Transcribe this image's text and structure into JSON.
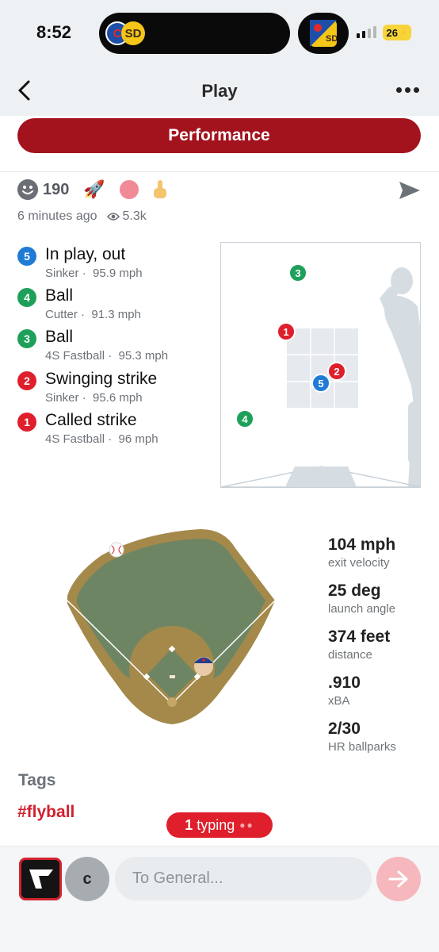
{
  "status_bar": {
    "time": "8:52",
    "battery": "26",
    "live_activity": {
      "away_team_icon": "cubs-logo-icon",
      "home_team_icon": "padres-logo-icon"
    }
  },
  "nav": {
    "title": "Play",
    "back_icon": "chevron-left-icon",
    "more_icon": "more-horizontal-icon"
  },
  "performance_button": "Performance",
  "post": {
    "reaction_count": "190",
    "reactions": [
      "rocket-emoji",
      "pink-circle-emoji",
      "finger-emoji"
    ],
    "time_ago": "6 minutes ago",
    "views": "5.3k"
  },
  "pitches": [
    {
      "num": "5",
      "result": "In play, out",
      "pitch_type": "Sinker",
      "speed": "95.9 mph",
      "color": "#1f7bd6"
    },
    {
      "num": "4",
      "result": "Ball",
      "pitch_type": "Cutter",
      "speed": "91.3 mph",
      "color": "#1fa05a"
    },
    {
      "num": "3",
      "result": "Ball",
      "pitch_type": "4S Fastball",
      "speed": "95.3 mph",
      "color": "#1fa05a"
    },
    {
      "num": "2",
      "result": "Swinging strike",
      "pitch_type": "Sinker",
      "speed": "95.6 mph",
      "color": "#df1f2c"
    },
    {
      "num": "1",
      "result": "Called strike",
      "pitch_type": "4S Fastball",
      "speed": "96 mph",
      "color": "#df1f2c"
    }
  ],
  "zone_markers": [
    {
      "num": "3",
      "color": "#1fa05a"
    },
    {
      "num": "1",
      "color": "#df1f2c"
    },
    {
      "num": "2",
      "color": "#df1f2c"
    },
    {
      "num": "5",
      "color": "#1f7bd6"
    },
    {
      "num": "4",
      "color": "#1fa05a"
    }
  ],
  "hit_stats": [
    {
      "value": "104 mph",
      "label": "exit velocity"
    },
    {
      "value": "25 deg",
      "label": "launch angle"
    },
    {
      "value": "374 feet",
      "label": "distance"
    },
    {
      "value": ".910",
      "label": "xBA"
    },
    {
      "value": "2/30",
      "label": "HR ballparks"
    }
  ],
  "tags": {
    "title": "Tags",
    "items": [
      "#flyball"
    ]
  },
  "typing_indicator": {
    "count": "1",
    "label": "typing"
  },
  "composer": {
    "avatar_initial": "c",
    "placeholder": "To General..."
  },
  "colors": {
    "brand_red": "#a3131d",
    "accent_red": "#df1f2c",
    "field_grass": "#6e8563",
    "field_dirt": "#a4894a"
  }
}
